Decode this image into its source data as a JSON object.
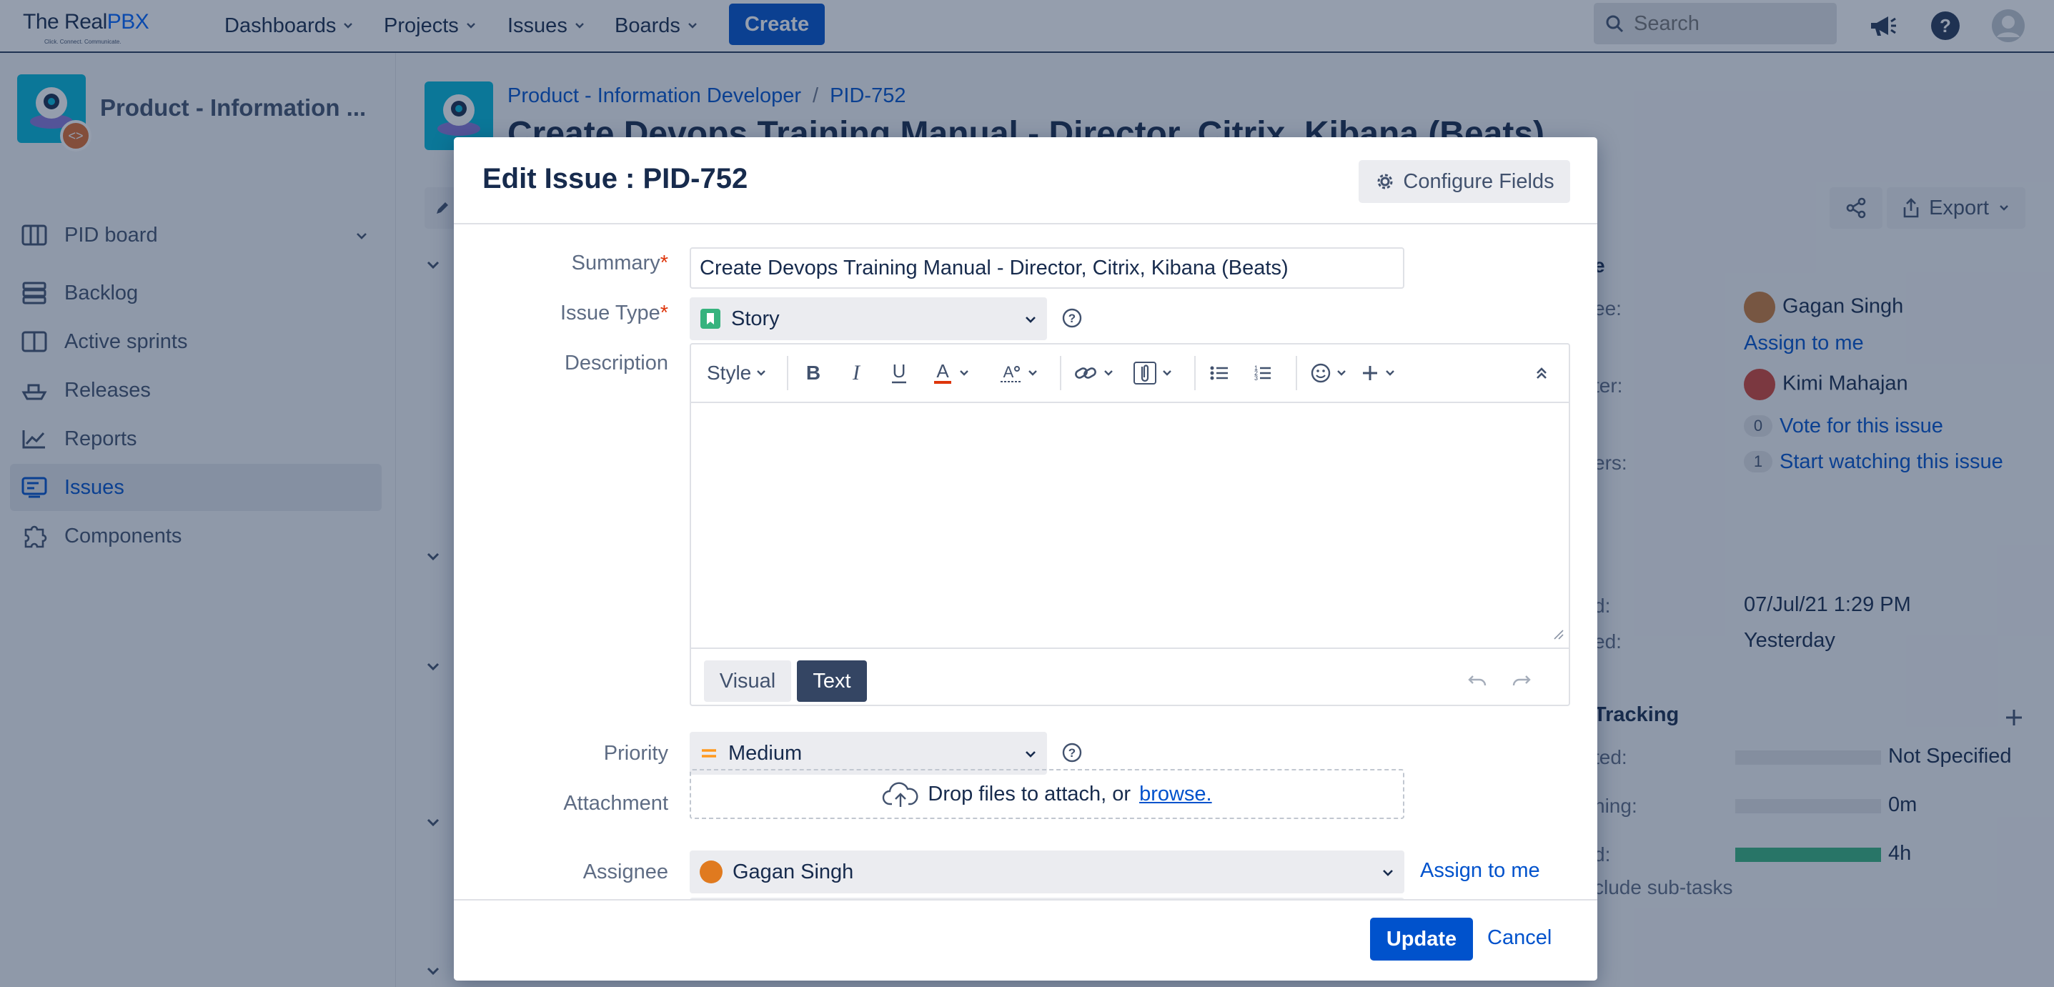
{
  "nav": {
    "brand_prefix": "The Real",
    "brand_suffix": "PBX",
    "tagline": "Click. Connect. Communicate.",
    "links": [
      "Dashboards",
      "Projects",
      "Issues",
      "Boards"
    ],
    "create_label": "Create",
    "search_placeholder": "Search"
  },
  "sidebar": {
    "project_name": "Product - Information ...",
    "items": [
      {
        "label": "PID board",
        "icon": "board-icon"
      },
      {
        "label": "Backlog",
        "icon": "backlog-icon"
      },
      {
        "label": "Active sprints",
        "icon": "sprint-icon"
      },
      {
        "label": "Releases",
        "icon": "ship-icon"
      },
      {
        "label": "Reports",
        "icon": "chart-icon"
      },
      {
        "label": "Issues",
        "icon": "issues-icon"
      },
      {
        "label": "Components",
        "icon": "puzzle-icon"
      }
    ],
    "active_item": "Issues"
  },
  "issue_page": {
    "breadcrumb": [
      "Product - Information Developer",
      "PID-752"
    ],
    "title": "Create Devops Training Manual - Director, Citrix, Kibana (Beats)",
    "export_label": "Export",
    "people": {
      "assignee_label": "ee:",
      "assignee": "Gagan Singh",
      "assign_to_me": "Assign to me",
      "reporter_label": "ter:",
      "reporter": "Kimi Mahajan",
      "votes_count": "0",
      "vote_label": "Vote for this issue",
      "watchers_label": "ers:",
      "watchers_count": "1",
      "watch_label": "Start watching this issue"
    },
    "dates": {
      "created_label": "d:",
      "created": "07/Jul/21 1:29 PM",
      "updated_label": "ed:",
      "updated": "Yesterday"
    },
    "time_tracking": {
      "title": "Tracking",
      "rows": [
        {
          "label": "ted:",
          "value": "Not Specified",
          "fill": "none"
        },
        {
          "label": "ning:",
          "value": "0m",
          "fill": "none"
        },
        {
          "label": "d:",
          "value": "4h",
          "fill": "full"
        }
      ],
      "subtasks_label": "clude sub-tasks"
    },
    "section_initial": "e"
  },
  "modal": {
    "title": "Edit Issue : PID-752",
    "configure_label": "Configure Fields",
    "summary_label": "Summary",
    "summary_value": "Create Devops Training Manual - Director, Citrix, Kibana (Beats)",
    "issue_type_label": "Issue Type",
    "issue_type_value": "Story",
    "description_label": "Description",
    "toolbar_style": "Style",
    "mode_visual": "Visual",
    "mode_text": "Text",
    "active_mode": "Text",
    "priority_label": "Priority",
    "priority_value": "Medium",
    "attachment_label": "Attachment",
    "drop_text": "Drop files to attach, or",
    "browse_label": "browse.",
    "assignee_label": "Assignee",
    "assignee_value": "Gagan Singh",
    "assign_to_me": "Assign to me",
    "update_label": "Update",
    "cancel_label": "Cancel",
    "required_marker": "*"
  },
  "colors": {
    "brand_blue": "#0052cc",
    "story_green": "#36b37e",
    "priority_orange": "#ff991f",
    "required_red": "#de350b"
  }
}
